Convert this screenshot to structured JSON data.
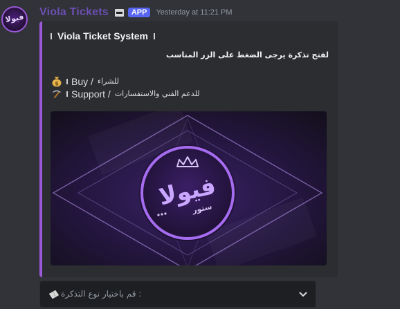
{
  "author": {
    "avatar_text": "فيولا",
    "name": "Viola Tickets",
    "badge": "APP",
    "timestamp": "Yesterday at 11:21 PM"
  },
  "embed": {
    "accent_color": "#9b59d9",
    "title": "Viola Ticket System",
    "description": "لفتح تذكرة يرجى الضغط على الزر المناسب",
    "lines": [
      {
        "icon": "money-bag-icon",
        "label": "Buy /",
        "arabic": "للشراء"
      },
      {
        "icon": "pick-icon",
        "label": "Support /",
        "arabic": "للدعم الفني والاستفسارات"
      }
    ],
    "image": {
      "logo_main": "فيولا",
      "logo_sub": "ستور"
    }
  },
  "select_menu": {
    "placeholder": "قم باختيار نوع التذكرة :",
    "icon": "ticket-icon"
  }
}
